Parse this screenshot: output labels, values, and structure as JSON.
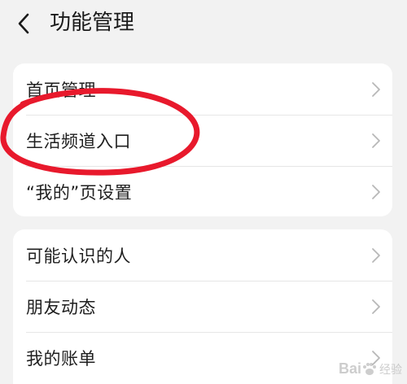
{
  "header": {
    "back_icon": "chevron-left-icon",
    "title": "功能管理"
  },
  "groups": [
    {
      "items": [
        {
          "label": "首页管理"
        },
        {
          "label": "生活频道入口"
        },
        {
          "label": "“我的”页设置"
        }
      ]
    },
    {
      "items": [
        {
          "label": "可能认识的人"
        },
        {
          "label": "朋友动态"
        },
        {
          "label": "我的账单"
        }
      ]
    }
  ],
  "row_icon": "chevron-right-icon",
  "annotation": {
    "shape": "red-ellipse",
    "color": "#e8192c",
    "target": "生活频道入口"
  },
  "watermark": {
    "brand": "Bai",
    "sub": "经验"
  },
  "colors": {
    "background": "#f2f2f2",
    "card": "#ffffff",
    "text": "#1f1f1f",
    "chevron": "#b8b8b8"
  }
}
